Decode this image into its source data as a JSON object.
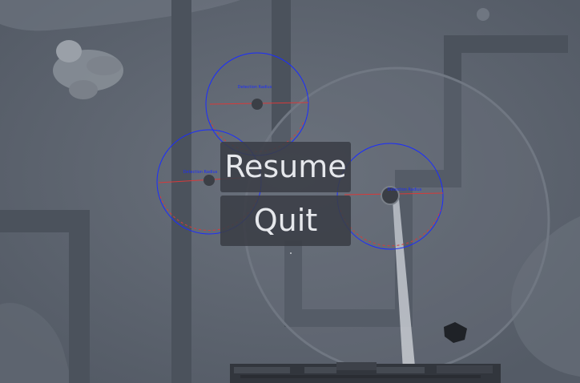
{
  "pause_menu": {
    "resume_label": "Resume",
    "quit_label": "Quit"
  },
  "scene": {
    "turret_labels": [
      "Detection Radius",
      "Detection Radius",
      "Detection Radius"
    ],
    "colors": {
      "ground": "#5d6470",
      "path": "#4b525c",
      "detection_ring": "#1a2cff",
      "aim_line": "#d63a3a",
      "range_circle": "#6b727d"
    }
  }
}
